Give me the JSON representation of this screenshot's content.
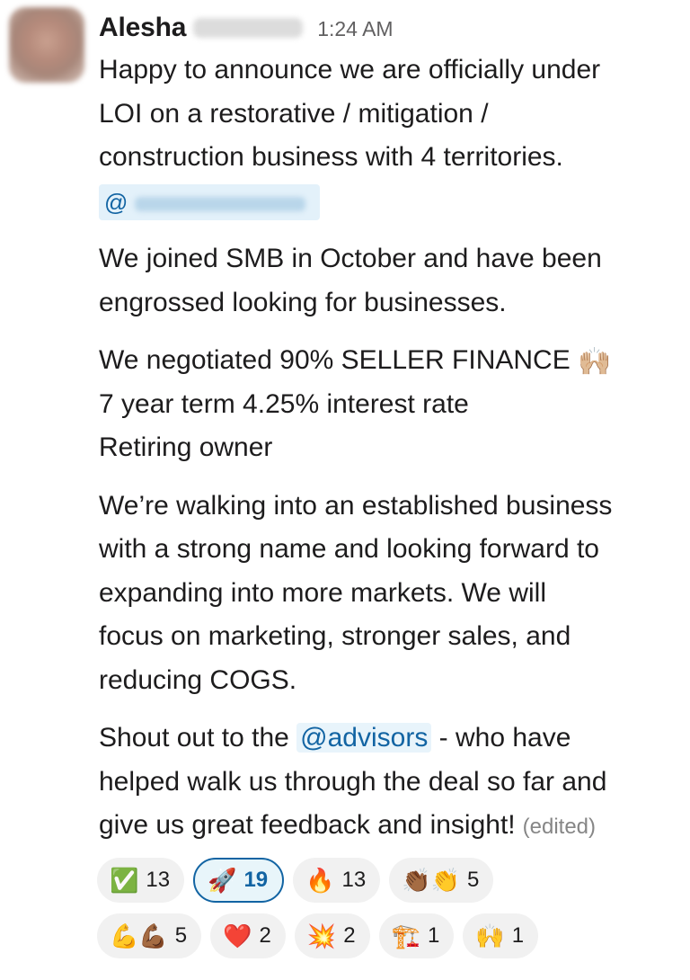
{
  "message": {
    "author": "Alesha",
    "time": "1:24 AM",
    "paragraphs": {
      "p1_line1": "Happy to announce we are officially under",
      "p1_line2": "LOI on a restorative / mitigation /",
      "p1_line3": "construction business with 4 territories.",
      "mention_prefix": "@",
      "p2_line1": "We joined SMB in October and have been",
      "p2_line2": "engrossed looking for businesses.",
      "p3_line1": "We negotiated 90% SELLER FINANCE",
      "p3_emoji": "🙌🏼",
      "p3_line2": "7 year term 4.25% interest rate",
      "p3_line3": "Retiring owner",
      "p4_line1": "We’re walking into an established business",
      "p4_line2": "with a strong name and looking forward to",
      "p4_line3": "expanding into more markets. We will",
      "p4_line4": "focus on marketing, stronger sales, and",
      "p4_line5": "reducing COGS.",
      "p5_pre": "Shout out to the ",
      "p5_mention": "@advisors",
      "p5_post": " - who have",
      "p5_line2": "helped walk us through the deal so far and",
      "p5_line3": "give us great feedback and insight!",
      "edited": "(edited)"
    }
  },
  "reactions": {
    "row1": [
      {
        "emoji": "✅",
        "count": "13"
      },
      {
        "emoji": "🚀",
        "count": "19",
        "active": true
      },
      {
        "emoji": "🔥",
        "count": "13"
      },
      {
        "emoji": "👏🏾👏",
        "count": "5"
      }
    ],
    "row2": [
      {
        "emoji": "💪💪🏾",
        "count": "5"
      },
      {
        "emoji": "❤️",
        "count": "2"
      },
      {
        "emoji": "💥",
        "count": "2"
      },
      {
        "emoji": "🏗️",
        "count": "1"
      },
      {
        "emoji": "🙌",
        "count": "1"
      }
    ]
  },
  "colors": {
    "link": "#1264a3",
    "mention_bg": "#e8f4fb",
    "pill_bg": "#f1f1f1",
    "timestamp": "#616061"
  }
}
